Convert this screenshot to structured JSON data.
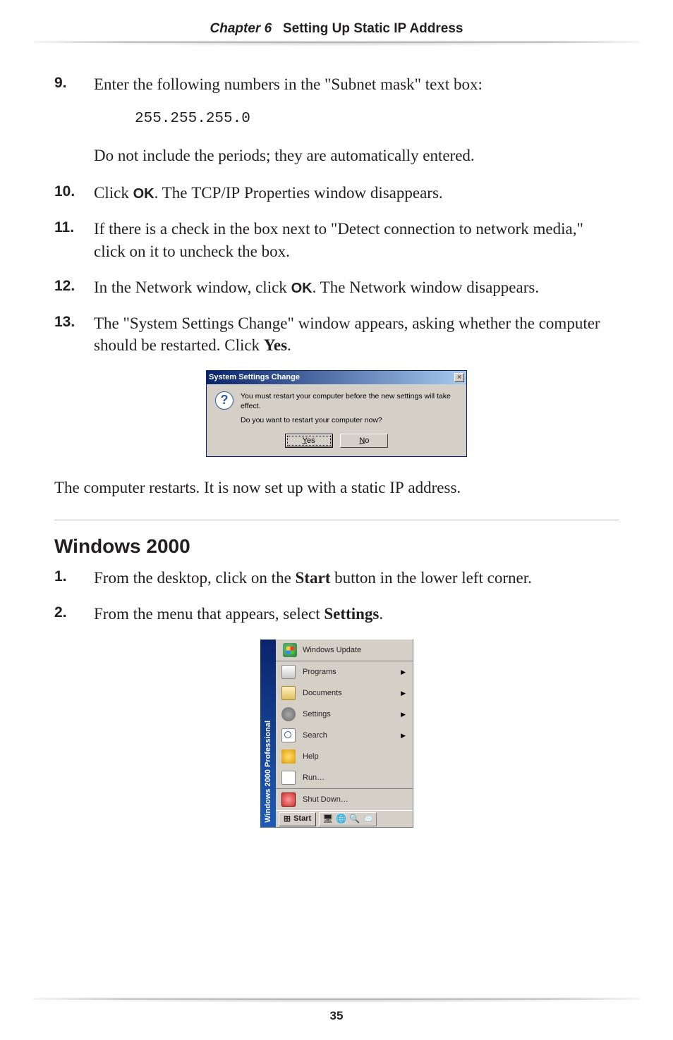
{
  "header": {
    "chapter": "Chapter 6",
    "title": "Setting Up Static IP Address"
  },
  "steps": {
    "s9": {
      "num": "9.",
      "text_a": "Enter the following numbers in the \"Subnet mask\" text box:",
      "code": "255.255.255.0",
      "text_b": "Do not include the periods; they are automatically entered."
    },
    "s10": {
      "num": "10.",
      "text_a": "Click ",
      "ok": "OK",
      "text_b": ". The ",
      "tcpip": "TCP/IP",
      "text_c": " Properties window disappears."
    },
    "s11": {
      "num": "11.",
      "text": "If there is a check in the box next to \"Detect connection to network media,\" click on it to uncheck the box."
    },
    "s12": {
      "num": "12.",
      "text_a": "In the Network window, click ",
      "ok": "OK",
      "text_b": ". The Network window disappears."
    },
    "s13": {
      "num": "13.",
      "text_a": "The \"System Settings Change\" window appears, asking whether the computer should be restarted. Click ",
      "yes": "Yes",
      "text_b": "."
    }
  },
  "dialog": {
    "title": "System Settings Change",
    "line1": "You must restart your computer before the new settings will take effect.",
    "line2": "Do you want to restart your computer now?",
    "yes_pre": "",
    "yes_u": "Y",
    "yes_post": "es",
    "no_u": "N",
    "no_post": "o"
  },
  "after": "The computer restarts. It is now set up with a static ",
  "after_ip": "IP",
  "after_tail": " address.",
  "section": {
    "title": "Windows 2000",
    "s1": {
      "num": "1.",
      "text_a": "From the desktop, click on the ",
      "start": "Start",
      "text_b": " button in the lower left corner."
    },
    "s2": {
      "num": "2.",
      "text_a": "From the menu that appears, select ",
      "settings": "Settings",
      "text_b": "."
    }
  },
  "startmenu": {
    "stripe": "Windows 2000 Professional",
    "wu": "Windows Update",
    "items": [
      {
        "label": "Programs",
        "arrow": true,
        "icon": "ic-programs"
      },
      {
        "label": "Documents",
        "arrow": true,
        "icon": "ic-docs"
      },
      {
        "label": "Settings",
        "arrow": true,
        "icon": "ic-settings"
      },
      {
        "label": "Search",
        "arrow": true,
        "icon": "ic-search"
      },
      {
        "label": "Help",
        "arrow": false,
        "icon": "ic-help"
      },
      {
        "label": "Run…",
        "arrow": false,
        "icon": "ic-run"
      }
    ],
    "shutdown": "Shut Down…",
    "start": "Start"
  },
  "page_number": "35"
}
